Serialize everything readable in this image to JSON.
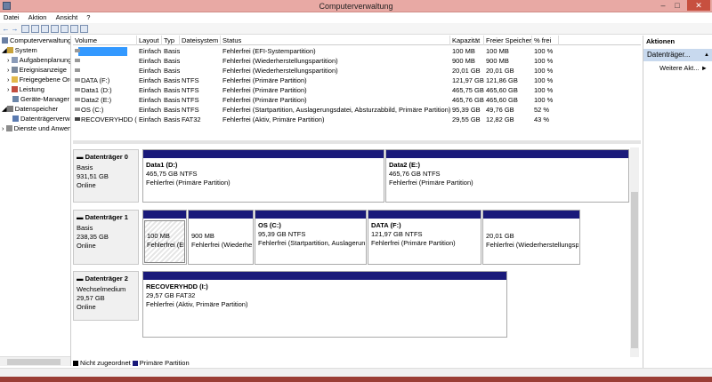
{
  "window": {
    "title": "Computerverwaltung",
    "minimize": "–",
    "maximize": "□",
    "close": "✕"
  },
  "menu": [
    "Datei",
    "Aktion",
    "Ansicht",
    "?"
  ],
  "toolbar": {
    "back": "←",
    "forward": "→"
  },
  "tree": [
    {
      "label": "Computerverwaltung",
      "icon": "computer-icon",
      "expander": ""
    },
    {
      "label": "System",
      "icon": "tools-icon",
      "expander": "◢"
    },
    {
      "label": "Aufgabenplanung",
      "icon": "clock-icon",
      "expander": "›"
    },
    {
      "label": "Ereignisanzeige",
      "icon": "event-viewer-icon",
      "expander": "›"
    },
    {
      "label": "Freigegebene Ordner",
      "icon": "shared-folder-icon",
      "expander": "›"
    },
    {
      "label": "Leistung",
      "icon": "performance-icon",
      "expander": "›"
    },
    {
      "label": "Geräte-Manager",
      "icon": "device-manager-icon",
      "expander": ""
    },
    {
      "label": "Datenspeicher",
      "icon": "storage-icon",
      "expander": "◢"
    },
    {
      "label": "Datenträgerverwaltung",
      "icon": "disk-management-icon",
      "expander": ""
    },
    {
      "label": "Dienste und Anwendungen",
      "icon": "services-icon",
      "expander": "›"
    }
  ],
  "volume_table": {
    "columns": [
      "Volume",
      "Layout",
      "Typ",
      "Dateisystem",
      "Status",
      "Kapazität",
      "Freier Speicher",
      "% frei"
    ],
    "rows": [
      {
        "volume": "",
        "layout": "Einfach",
        "typ": "Basis",
        "fs": "",
        "status": "Fehlerfrei (EFI-Systempartition)",
        "cap": "100 MB",
        "free": "100 MB",
        "pct": "100 %"
      },
      {
        "volume": "",
        "layout": "Einfach",
        "typ": "Basis",
        "fs": "",
        "status": "Fehlerfrei (Wiederherstellungspartition)",
        "cap": "900 MB",
        "free": "900 MB",
        "pct": "100 %"
      },
      {
        "volume": "",
        "layout": "Einfach",
        "typ": "Basis",
        "fs": "",
        "status": "Fehlerfrei (Wiederherstellungspartition)",
        "cap": "20,01 GB",
        "free": "20,01 GB",
        "pct": "100 %"
      },
      {
        "volume": "DATA (F:)",
        "layout": "Einfach",
        "typ": "Basis",
        "fs": "NTFS",
        "status": "Fehlerfrei (Primäre Partition)",
        "cap": "121,97 GB",
        "free": "121,86 GB",
        "pct": "100 %"
      },
      {
        "volume": "Data1 (D:)",
        "layout": "Einfach",
        "typ": "Basis",
        "fs": "NTFS",
        "status": "Fehlerfrei (Primäre Partition)",
        "cap": "465,75 GB",
        "free": "465,60 GB",
        "pct": "100 %"
      },
      {
        "volume": "Data2 (E:)",
        "layout": "Einfach",
        "typ": "Basis",
        "fs": "NTFS",
        "status": "Fehlerfrei (Primäre Partition)",
        "cap": "465,76 GB",
        "free": "465,60 GB",
        "pct": "100 %"
      },
      {
        "volume": "OS (C:)",
        "layout": "Einfach",
        "typ": "Basis",
        "fs": "NTFS",
        "status": "Fehlerfrei (Startpartition, Auslagerungsdatei, Absturzabbild, Primäre Partition)",
        "cap": "95,39 GB",
        "free": "49,76 GB",
        "pct": "52 %"
      },
      {
        "volume": "RECOVERYHDD (I:)",
        "layout": "Einfach",
        "typ": "Basis",
        "fs": "FAT32",
        "status": "Fehlerfrei (Aktiv, Primäre Partition)",
        "cap": "29,55 GB",
        "free": "12,82 GB",
        "pct": "43 %"
      }
    ]
  },
  "disks": [
    {
      "name": "Datenträger 0",
      "type": "Basis",
      "size": "931,51 GB",
      "state": "Online",
      "partitions": [
        {
          "name": "Data1  (D:)",
          "size": "465,75 GB NTFS",
          "status": "Fehlerfrei (Primäre Partition)"
        },
        {
          "name": "Data2  (E:)",
          "size": "465,76 GB NTFS",
          "status": "Fehlerfrei (Primäre Partition)"
        }
      ]
    },
    {
      "name": "Datenträger 1",
      "type": "Basis",
      "size": "238,35 GB",
      "state": "Online",
      "partitions": [
        {
          "name": "",
          "size": "100 MB",
          "status": "Fehlerfrei (EFI"
        },
        {
          "name": "",
          "size": "900 MB",
          "status": "Fehlerfrei (Wiederher"
        },
        {
          "name": "OS  (C:)",
          "size": "95,39 GB NTFS",
          "status": "Fehlerfrei (Startpartition, Auslagerun"
        },
        {
          "name": "DATA  (F:)",
          "size": "121,97 GB NTFS",
          "status": "Fehlerfrei (Primäre Partition)"
        },
        {
          "name": "",
          "size": "20,01 GB",
          "status": "Fehlerfrei (Wiederherstellungspa"
        }
      ]
    },
    {
      "name": "Datenträger 2",
      "type": "Wechselmedium",
      "size": "29,57 GB",
      "state": "Online",
      "partitions": [
        {
          "name": "RECOVERYHDD  (I:)",
          "size": "29,57 GB FAT32",
          "status": "Fehlerfrei (Aktiv, Primäre Partition)"
        }
      ]
    }
  ],
  "legend": {
    "unallocated": "Nicht zugeordnet",
    "primary": "Primäre Partition",
    "unallocated_color": "#000000",
    "primary_color": "#1a1a7a"
  },
  "actions": {
    "header": "Aktionen",
    "selected": "Datenträger...",
    "selected_arrow": "▲",
    "item": "Weitere Akt...",
    "item_arrow": "►"
  }
}
